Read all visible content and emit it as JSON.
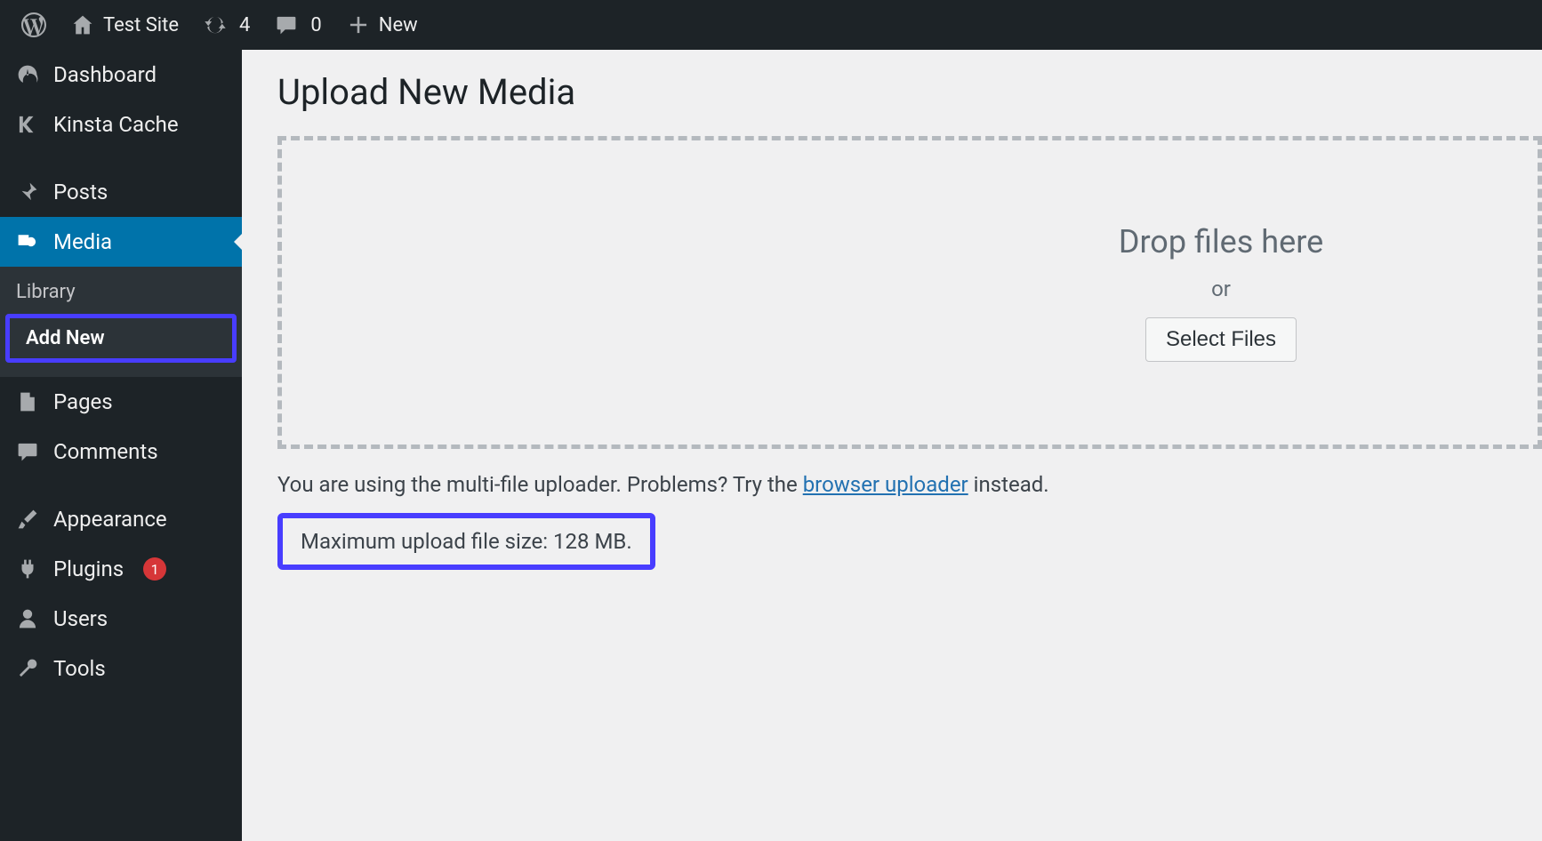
{
  "adminbar": {
    "site_name": "Test Site",
    "updates_count": "4",
    "comments_count": "0",
    "new_label": "New"
  },
  "sidebar": {
    "dashboard": "Dashboard",
    "kinsta": "Kinsta Cache",
    "posts": "Posts",
    "media": "Media",
    "media_sub": {
      "library": "Library",
      "addnew": "Add New"
    },
    "pages": "Pages",
    "comments": "Comments",
    "appearance": "Appearance",
    "plugins": "Plugins",
    "plugins_badge": "1",
    "users": "Users",
    "tools": "Tools"
  },
  "main": {
    "title": "Upload New Media",
    "drop_title": "Drop files here",
    "or": "or",
    "select_files": "Select Files",
    "note_pre": "You are using the multi-file uploader. Problems? Try the ",
    "note_link": "browser uploader",
    "note_post": " instead.",
    "max_size": "Maximum upload file size: 128 MB."
  }
}
